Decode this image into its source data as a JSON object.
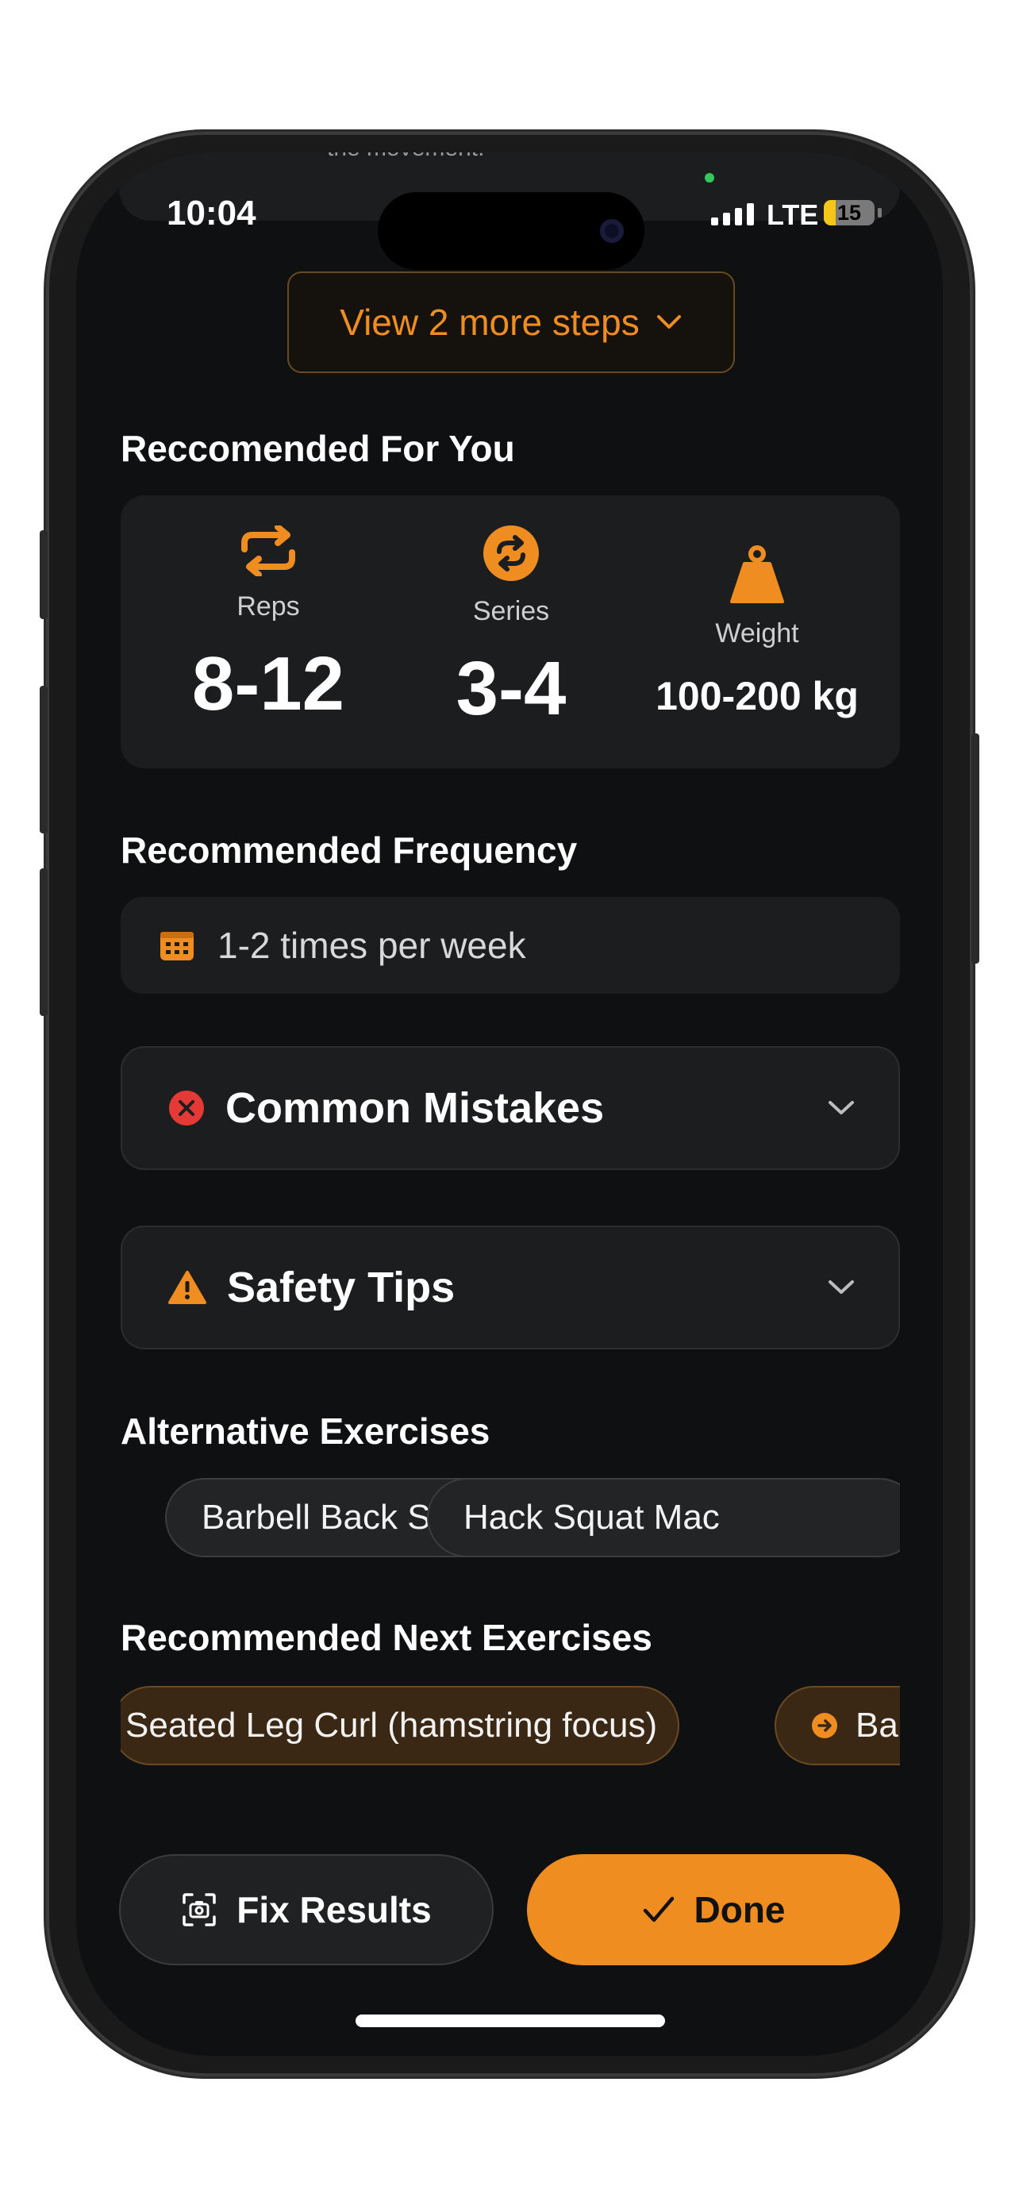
{
  "status_bar": {
    "time": "10:04",
    "network": "LTE",
    "battery": "15"
  },
  "previous_step": {
    "text": "the movement."
  },
  "steps_toggle": {
    "label": "View 2 more steps",
    "icon": "chevron-down-icon"
  },
  "recommended": {
    "title": "Reccomended For You",
    "metrics": [
      {
        "label": "Reps",
        "value": "8-12",
        "icon": "repeat-icon"
      },
      {
        "label": "Series",
        "value": "3-4",
        "icon": "cycle-icon"
      },
      {
        "label": "Weight",
        "value": "100-200 kg",
        "icon": "kettlebell-icon"
      }
    ]
  },
  "frequency": {
    "title": "Recommended Frequency",
    "value": "1-2 times per week",
    "icon": "calendar-icon"
  },
  "mistakes": {
    "label": "Common Mistakes",
    "icon": "error-circle-icon"
  },
  "safety": {
    "label": "Safety Tips",
    "icon": "warning-icon"
  },
  "alternatives": {
    "title": "Alternative Exercises",
    "items": [
      "Barbell Back Squat",
      "Hack Squat Mac"
    ]
  },
  "next_exercises": {
    "title": "Recommended Next Exercises",
    "items": [
      "Seated Leg Curl (hamstring focus)",
      "Ba"
    ]
  },
  "actions": {
    "fix_label": "Fix Results",
    "done_label": "Done"
  },
  "colors": {
    "accent": "#f08d20",
    "background": "#0f1011",
    "card": "#1c1d1f",
    "error": "#e53935"
  }
}
